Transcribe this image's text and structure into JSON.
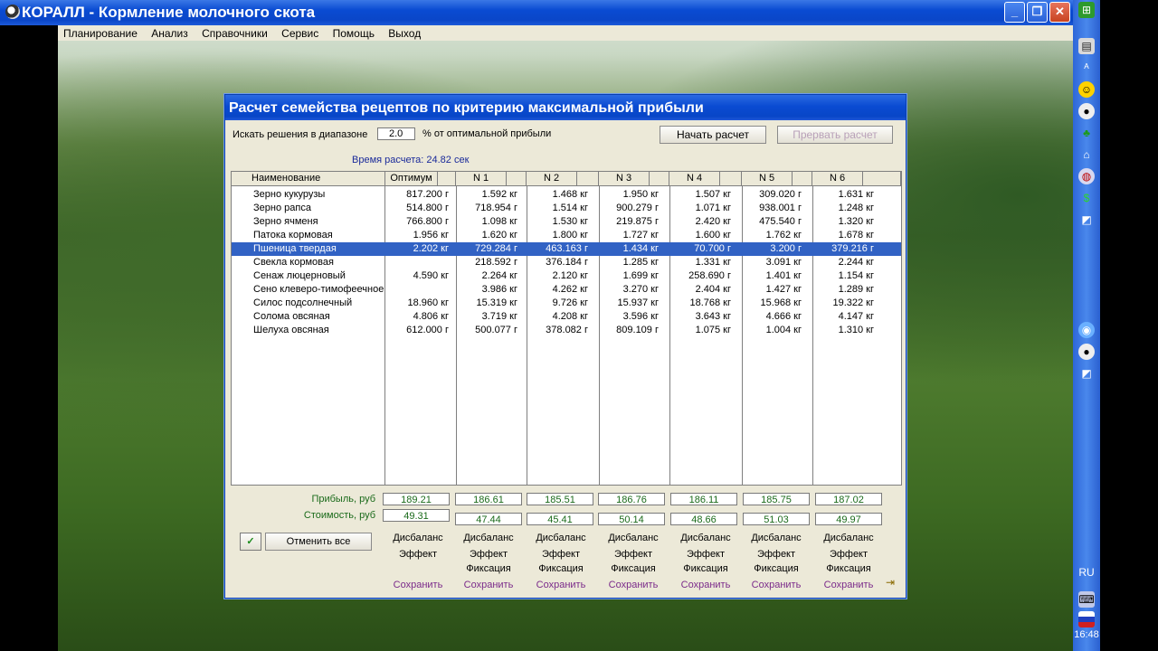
{
  "window": {
    "title": "КОРАЛЛ - Кормление молочного скота"
  },
  "menu": [
    "Планирование",
    "Анализ",
    "Справочники",
    "Сервис",
    "Помощь",
    "Выход"
  ],
  "dialog": {
    "title": "Расчет семейства рецептов по критерию максимальной прибыли",
    "search_label": "Искать решения в диапазоне",
    "range_value": "2.0",
    "range_suffix": "% от оптимальной прибыли",
    "start_button": "Начать расчет",
    "stop_button": "Прервать расчет",
    "calc_time": "Время расчета: 24.82 сек"
  },
  "table": {
    "columns": [
      "Наименование",
      "Оптимум",
      "N 1",
      "N 2",
      "N 3",
      "N 4",
      "N 5",
      "N 6"
    ],
    "selected_row": 4,
    "rows": [
      {
        "name": "Зерно кукурузы",
        "vals": [
          "817.200 г",
          "1.592 кг",
          "1.468 кг",
          "1.950 кг",
          "1.507 кг",
          "309.020 г",
          "1.631 кг"
        ]
      },
      {
        "name": "Зерно рапса",
        "vals": [
          "514.800 г",
          "718.954 г",
          "1.514 кг",
          "900.279 г",
          "1.071 кг",
          "938.001 г",
          "1.248 кг"
        ]
      },
      {
        "name": "Зерно ячменя",
        "vals": [
          "766.800 г",
          "1.098 кг",
          "1.530 кг",
          "219.875 г",
          "2.420 кг",
          "475.540 г",
          "1.320 кг"
        ]
      },
      {
        "name": "Патока кормовая",
        "vals": [
          "1.956 кг",
          "1.620 кг",
          "1.800 кг",
          "1.727 кг",
          "1.600 кг",
          "1.762 кг",
          "1.678 кг"
        ]
      },
      {
        "name": "Пшеница твердая",
        "vals": [
          "2.202 кг",
          "729.284 г",
          "463.163 г",
          "1.434 кг",
          "70.700 г",
          "3.200 г",
          "379.216 г"
        ]
      },
      {
        "name": "Свекла кормовая",
        "vals": [
          "",
          "218.592 г",
          "376.184 г",
          "1.285 кг",
          "1.331 кг",
          "3.091 кг",
          "2.244 кг"
        ]
      },
      {
        "name": "Сенаж люцерновый",
        "vals": [
          "4.590 кг",
          "2.264 кг",
          "2.120 кг",
          "1.699 кг",
          "258.690 г",
          "1.401 кг",
          "1.154 кг"
        ]
      },
      {
        "name": "Сено клеверо-тимофеечное",
        "vals": [
          "",
          "3.986 кг",
          "4.262 кг",
          "3.270 кг",
          "2.404 кг",
          "1.427 кг",
          "1.289 кг"
        ]
      },
      {
        "name": "Силос подсолнечный",
        "vals": [
          "18.960 кг",
          "15.319 кг",
          "9.726 кг",
          "15.937 кг",
          "18.768 кг",
          "15.968 кг",
          "19.322 кг"
        ]
      },
      {
        "name": "Солома овсяная",
        "vals": [
          "4.806 кг",
          "3.719 кг",
          "4.208 кг",
          "3.596 кг",
          "3.643 кг",
          "4.666 кг",
          "4.147 кг"
        ]
      },
      {
        "name": "Шелуха овсяная",
        "vals": [
          "612.000 г",
          "500.077 г",
          "378.082 г",
          "809.109 г",
          "1.075 кг",
          "1.004 кг",
          "1.310 кг"
        ]
      }
    ]
  },
  "summary": {
    "profit_label": "Прибыль, руб",
    "cost_label": "Стоимость, руб",
    "profit": [
      "189.21",
      "186.61",
      "185.51",
      "186.76",
      "186.11",
      "185.75",
      "187.02"
    ],
    "cost": [
      "49.31",
      "47.44",
      "45.41",
      "50.14",
      "48.66",
      "51.03",
      "49.97"
    ],
    "cancel_all": "Отменить все",
    "check": "✓",
    "imbalance": "Дисбаланс",
    "effect": "Эффект",
    "fixation": "Фиксация",
    "save": "Сохранить"
  },
  "taskbar": {
    "lang": "RU",
    "clock": "16:48"
  }
}
